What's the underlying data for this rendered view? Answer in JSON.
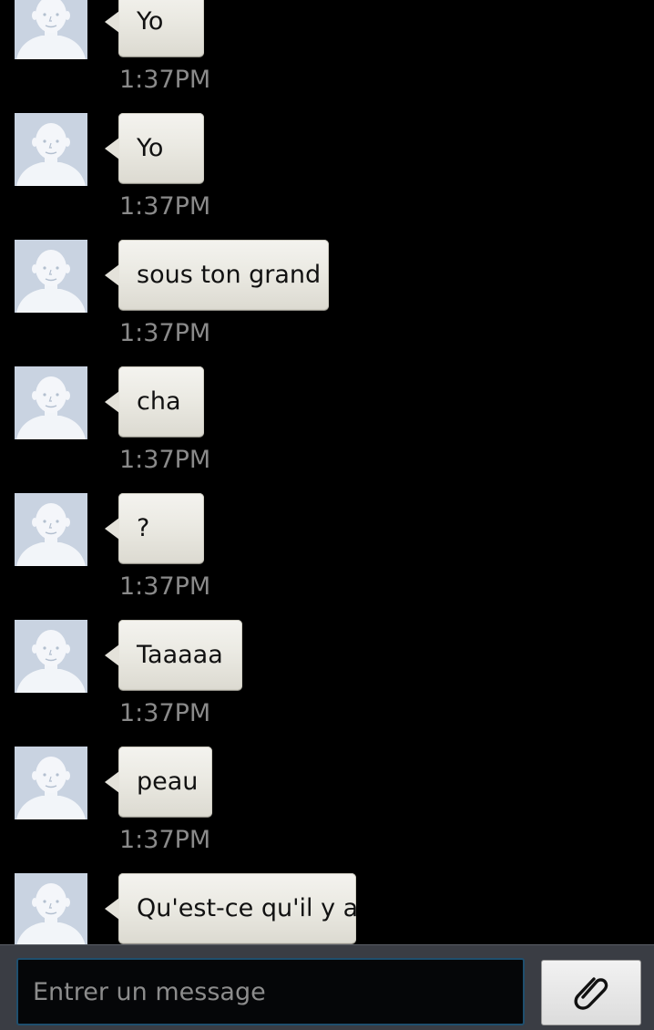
{
  "composer": {
    "placeholder": "Entrer un message",
    "attach_icon": "paperclip-icon"
  },
  "avatar_icon": "default-contact-icon",
  "messages": [
    {
      "text": "Yo",
      "time": "1:37PM"
    },
    {
      "text": "Yo",
      "time": "1:37PM"
    },
    {
      "text": "sous ton grand",
      "time": "1:37PM"
    },
    {
      "text": "cha",
      "time": "1:37PM"
    },
    {
      "text": "?",
      "time": "1:37PM"
    },
    {
      "text": "Taaaaa",
      "time": "1:37PM"
    },
    {
      "text": "peau",
      "time": "1:37PM"
    },
    {
      "text": "Qu'est-ce qu'il y a",
      "time": ""
    }
  ]
}
